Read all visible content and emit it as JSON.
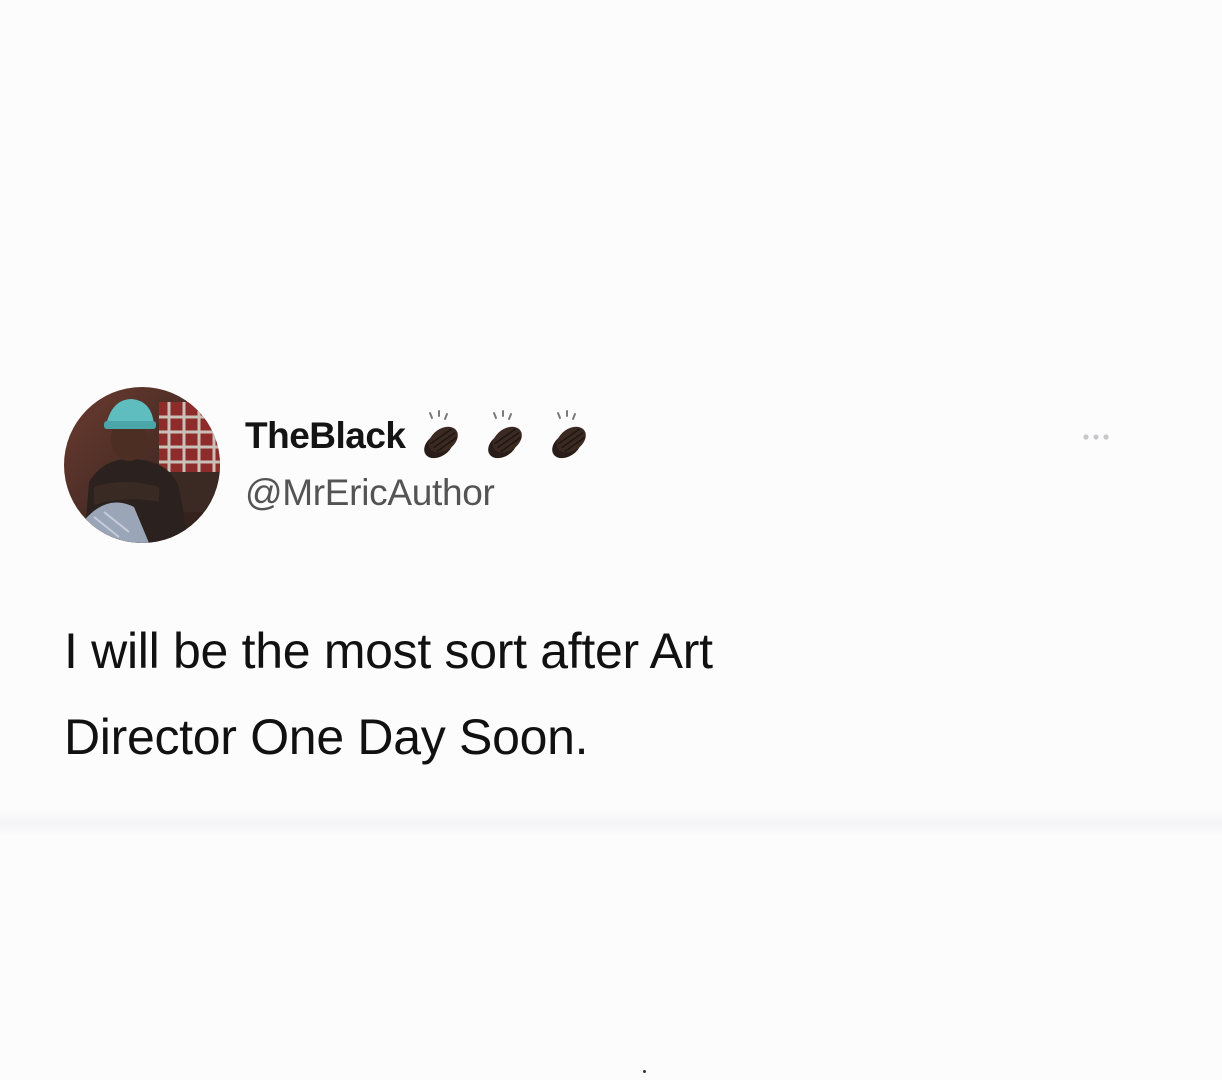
{
  "tweet": {
    "display_name": "TheBlack",
    "display_name_emojis": [
      "clapping-hands-icon",
      "clapping-hands-icon",
      "clapping-hands-icon"
    ],
    "handle": "@MrEricAuthor",
    "text_line1": "I will be the most sort after Art",
    "text_line2": "Director One Day Soon.",
    "more_icon": "ellipsis-icon"
  },
  "colors": {
    "background": "#fdfcfd",
    "name": "#141414",
    "handle": "#545454",
    "emoji_skin": "#3b2a22"
  }
}
